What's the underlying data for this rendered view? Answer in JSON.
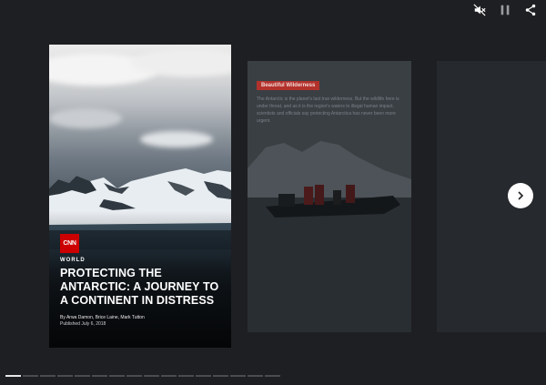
{
  "controls": {
    "mute_icon": "volume-muted-icon",
    "pause_icon": "pause-icon",
    "share_icon": "share-icon"
  },
  "story": {
    "brand": "CNN",
    "section": "WORLD",
    "headline": "PROTECTING THE ANTARCTIC: A JOURNEY TO A CONTINENT IN DISTRESS",
    "byline": "By Arwa Damon, Brice Laine, Mark Tutton",
    "published": "Published July 6, 2018"
  },
  "next_story": {
    "tag": "Beautiful Wilderness",
    "text": "The Antarctic is the planet's last true wilderness. But the wildlife here is under threat, and as it is the region's waters to illegal human impact, scientists and officials say protecting Antarctica has never been more urgent."
  },
  "progress": {
    "total_segments": 16,
    "active_index": 0
  },
  "colors": {
    "background": "#1e1f22",
    "brand_red": "#cc0000",
    "tag_red": "#b3312b"
  }
}
